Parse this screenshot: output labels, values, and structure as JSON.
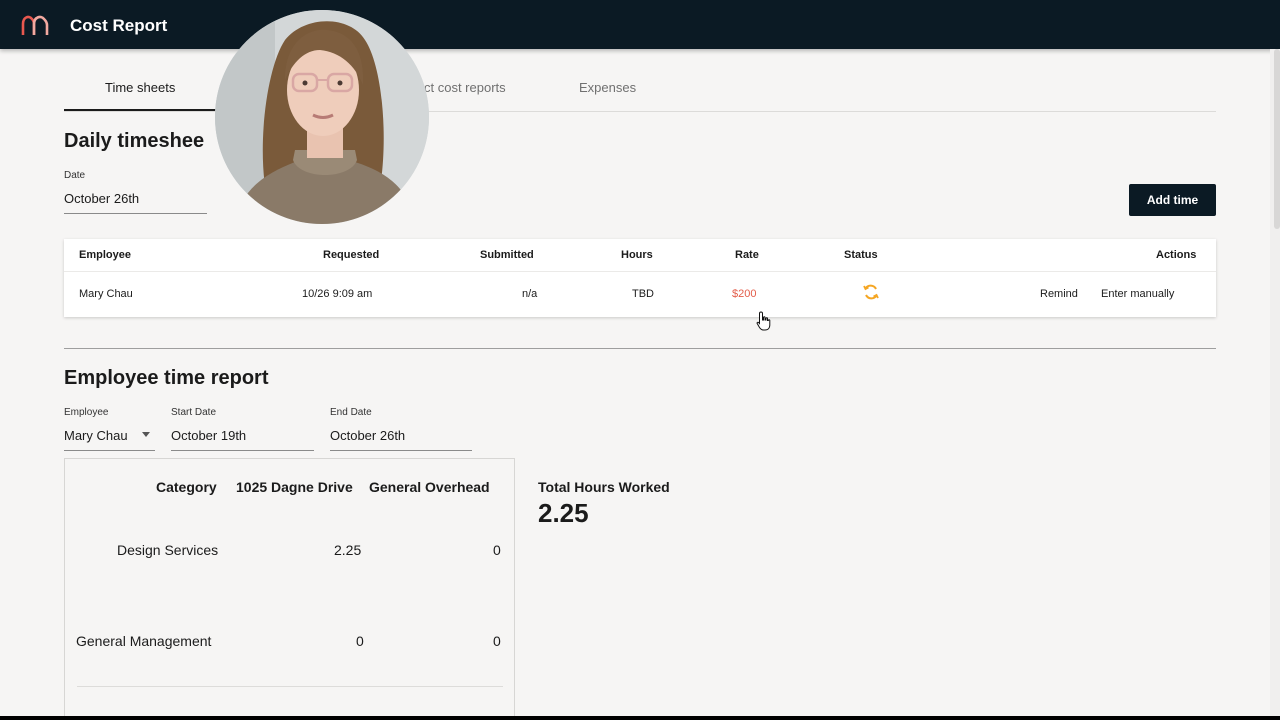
{
  "header": {
    "title": "Cost Report",
    "logo_icon": "arch-logo-icon"
  },
  "tabs": [
    {
      "label": "Time sheets",
      "active": true
    },
    {
      "label": "ct cost reports",
      "active": false
    },
    {
      "label": "Expenses",
      "active": false
    }
  ],
  "daily": {
    "title": "Daily timeshee",
    "date_label": "Date",
    "date_value": "October 26th",
    "add_button": "Add time"
  },
  "timesheet": {
    "columns": [
      "Employee",
      "Requested",
      "Submitted",
      "Hours",
      "Rate",
      "Status",
      "Actions"
    ],
    "rows": [
      {
        "employee": "Mary Chau",
        "requested": "10/26 9:09 am",
        "submitted": "n/a",
        "hours": "TBD",
        "rate": "$200",
        "status_icon": "sync-icon",
        "actions": [
          "Remind",
          "Enter manually"
        ]
      }
    ]
  },
  "report": {
    "title": "Employee time report",
    "employee_label": "Employee",
    "employee_value": "Mary Chau",
    "start_label": "Start Date",
    "start_value": "October 19th",
    "end_label": "End Date",
    "end_value": "October 26th",
    "table": {
      "headers": [
        "Category",
        "1025 Dagne Drive",
        "General Overhead"
      ],
      "rows": [
        {
          "category": "Design Services",
          "dagne": "2.25",
          "overhead": "0"
        },
        {
          "category": "General Management",
          "dagne": "0",
          "overhead": "0"
        }
      ]
    },
    "total_label": "Total Hours Worked",
    "total_value": "2.25"
  },
  "colors": {
    "header_bg": "#0b1a24",
    "rate": "#e35d4a",
    "status": "#f5a623",
    "logo": "#e8584f"
  }
}
